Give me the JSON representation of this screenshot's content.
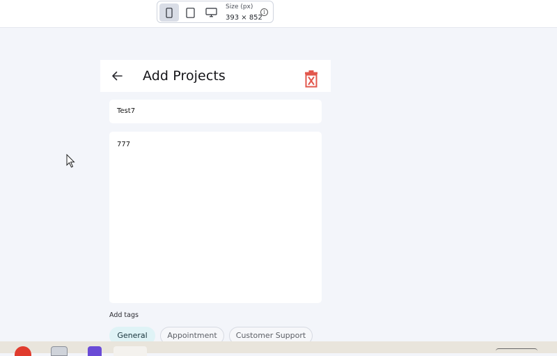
{
  "toolbar": {
    "size_label": "Size (px)",
    "size_value": "393 × 852",
    "devices": [
      "phone-icon",
      "tablet-icon",
      "desktop-icon"
    ],
    "active_device": "phone"
  },
  "app": {
    "title": "Add Projects",
    "fields": {
      "title_value": "Test7",
      "description_value": "777"
    },
    "tags_label": "Add tags",
    "tags": [
      {
        "label": "General",
        "selected": true
      },
      {
        "label": "Appointment",
        "selected": false
      },
      {
        "label": "Customer Support",
        "selected": false
      }
    ]
  },
  "colors": {
    "accent_delete": "#e2574c",
    "chip_selected_bg": "#dff3f6",
    "page_bg": "#f3f5fa"
  }
}
